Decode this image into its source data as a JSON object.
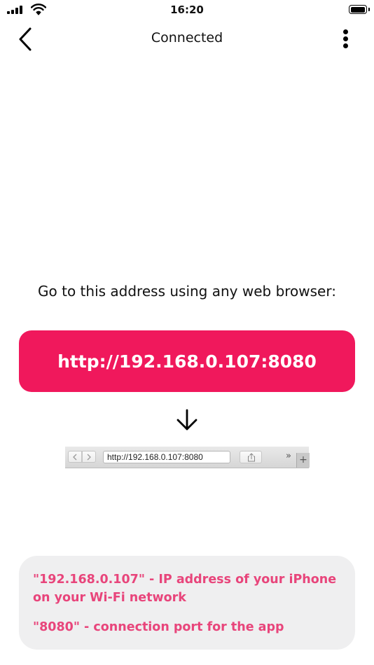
{
  "status_bar": {
    "time": "16:20",
    "icons": [
      "signal-icon",
      "wifi-icon",
      "battery-icon"
    ]
  },
  "nav": {
    "title": "Connected",
    "back_icon": "chevron-left-icon",
    "menu_icon": "more-vertical-icon"
  },
  "main": {
    "instruction": "Go to this address using any web browser:",
    "address": "http://192.168.0.107:8080",
    "arrow_icon": "arrow-down-icon"
  },
  "browser_preview": {
    "url": "http://192.168.0.107:8080",
    "chevrons": "»",
    "plus": "+"
  },
  "info": {
    "ip_note": "\"192.168.0.107\" - IP address of your iPhone on your Wi-Fi network",
    "port_note": "\"8080\" - connection port for the app"
  },
  "colors": {
    "accent": "#f0185c",
    "info_text": "#e8457b",
    "info_background": "#efeff0"
  }
}
